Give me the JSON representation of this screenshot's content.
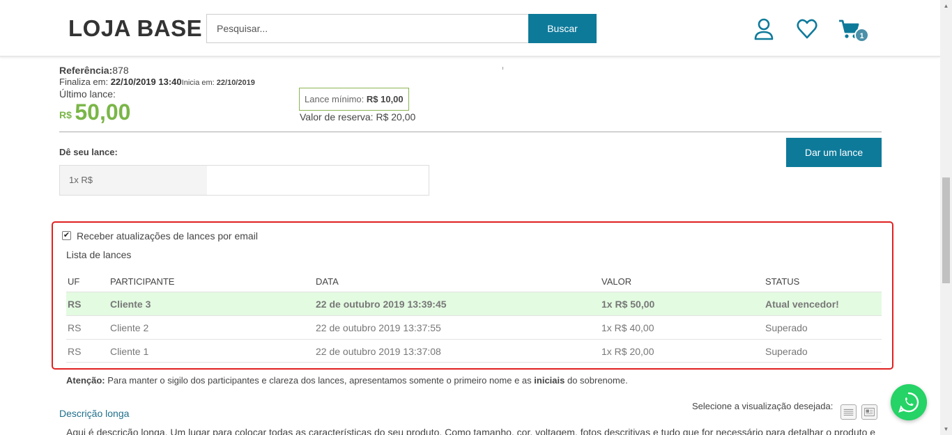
{
  "header": {
    "logo": "LOJA BASE",
    "search_placeholder": "Pesquisar...",
    "search_button": "Buscar",
    "cart_count": "1"
  },
  "product": {
    "ref_label": "Referência:",
    "ref_value": "878",
    "ends_label": "Finaliza em: ",
    "ends_value": "22/10/2019 13:40",
    "starts_label": "Inicia em: ",
    "starts_value": "22/10/2019",
    "last_bid_label": "Último lance:",
    "last_bid_currency": "R$",
    "last_bid_value": "50,00",
    "min_bid_label": "Lance mínimo: ",
    "min_bid_value": "R$ 10,00",
    "reserve_label": "Valor de reserva: ",
    "reserve_value": "R$ 20,00"
  },
  "bid_form": {
    "label": "Dê seu lance:",
    "prefix": "1x R$",
    "button": "Dar um lance"
  },
  "bids": {
    "notify_label": "Receber atualizações de lances por email",
    "notify_checked": true,
    "list_title": "Lista de lances",
    "columns": [
      "UF",
      "PARTICIPANTE",
      "DATA",
      "VALOR",
      "STATUS"
    ],
    "rows": [
      {
        "uf": "RS",
        "participant": "Cliente 3",
        "date": "22 de outubro 2019 13:39:45",
        "value": "1x R$ 50,00",
        "status": "Atual vencedor!"
      },
      {
        "uf": "RS",
        "participant": "Cliente 2",
        "date": "22 de outubro 2019 13:37:55",
        "value": "1x R$ 40,00",
        "status": "Superado"
      },
      {
        "uf": "RS",
        "participant": "Cliente 1",
        "date": "22 de outubro 2019 13:37:08",
        "value": "1x R$ 20,00",
        "status": "Superado"
      }
    ]
  },
  "notice": {
    "bold_prefix": "Atenção:",
    "text_before": " Para manter o sigilo dos participantes e clareza dos lances, apresentamos somente o primeiro nome e as ",
    "bold_mid": "iniciais",
    "text_after": " do sobrenome."
  },
  "description": {
    "link": "Descrição longa",
    "view_label": "Selecione a visualização desejada:",
    "text": "Aqui é descrição longa. Um lugar para colocar todas as características do seu produto. Como tamanho, cor, voltagem, fotos descritivas e tudo que for necessário para detalhar o produto e"
  },
  "colors": {
    "accent": "#0e7a9a",
    "price_green": "#7ab648",
    "winner_row": "#e3fbe1",
    "highlight_border": "#e02020",
    "whatsapp": "#25d366"
  },
  "icons": [
    "user-icon",
    "heart-icon",
    "cart-icon",
    "whatsapp-icon",
    "list-view-icon",
    "detail-view-icon"
  ]
}
